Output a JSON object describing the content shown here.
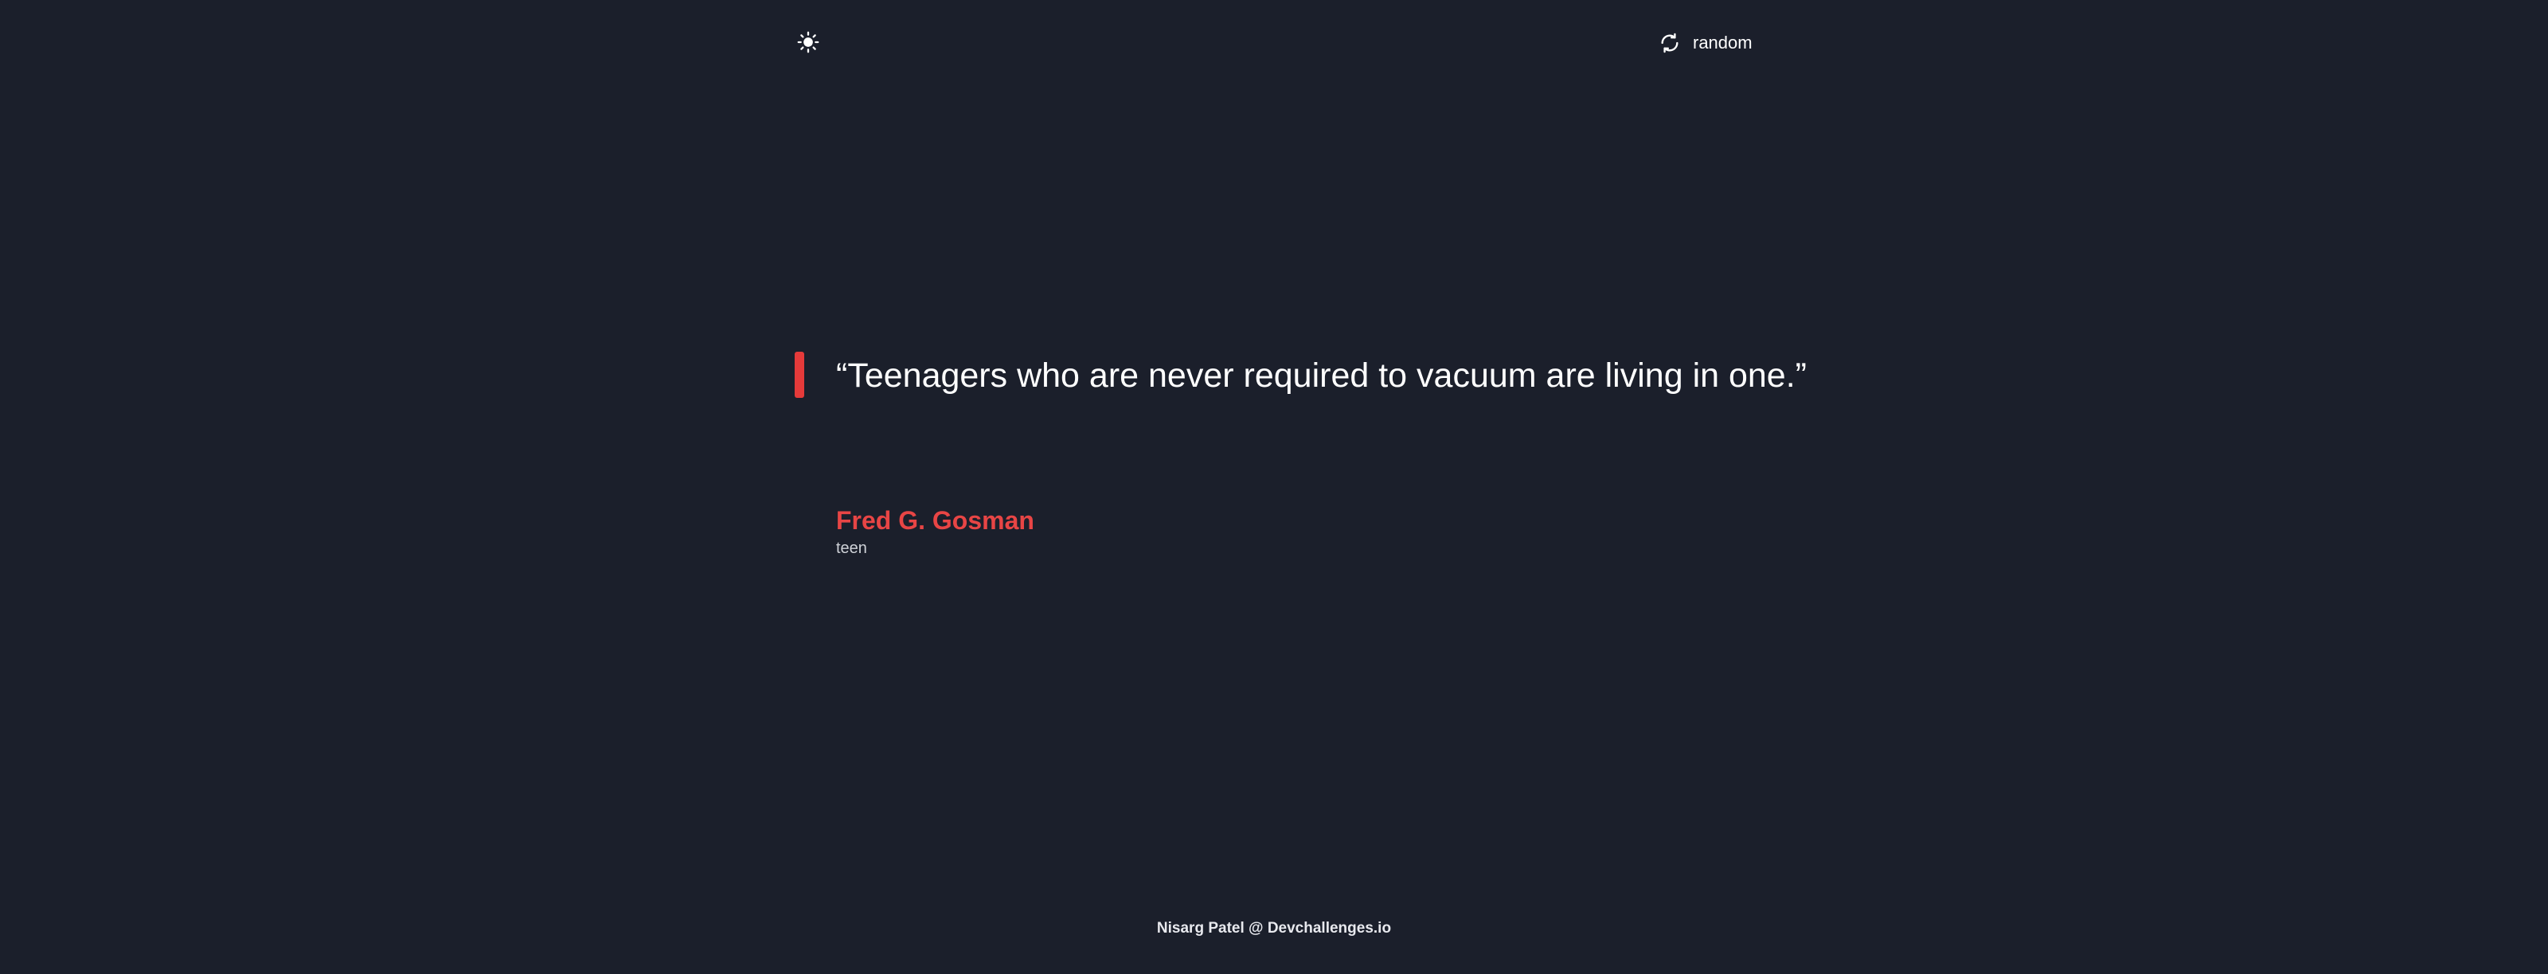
{
  "header": {
    "theme_toggle_icon": "sun-icon",
    "random_label": "random",
    "random_icon": "refresh-icon"
  },
  "quote": {
    "text": "“Teenagers who are never required to vacuum are living in one.”",
    "author": "Fred G. Gosman",
    "genre": "teen",
    "accent_color": "#e84545"
  },
  "footer": {
    "credit": "Nisarg Patel @ Devchallenges.io"
  },
  "colors": {
    "background": "#1b1f2b",
    "text": "#ffffff",
    "accent": "#e84545"
  }
}
